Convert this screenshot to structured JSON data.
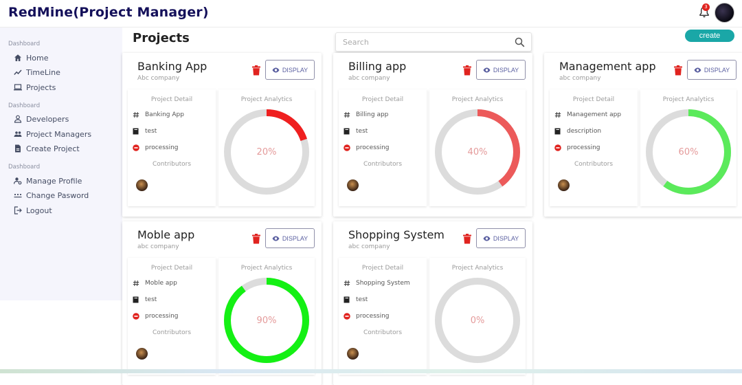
{
  "app": {
    "title": "RedMine(Project Manager)",
    "notification_count": "3"
  },
  "sidebar": {
    "sections": [
      {
        "title": "Dashboard",
        "items": [
          {
            "label": "Home",
            "icon": "home-icon"
          },
          {
            "label": "TimeLine",
            "icon": "timeline-icon"
          },
          {
            "label": "Projects",
            "icon": "laptop-icon"
          }
        ]
      },
      {
        "title": "Dashboard",
        "items": [
          {
            "label": "Developers",
            "icon": "person-icon"
          },
          {
            "label": "Project Managers",
            "icon": "group-icon"
          },
          {
            "label": "Create Project",
            "icon": "document-icon"
          }
        ]
      },
      {
        "title": "Dashboard",
        "items": [
          {
            "label": "Manage Profile",
            "icon": "manage-profile-icon"
          },
          {
            "label": "Change Pasword",
            "icon": "password-icon"
          },
          {
            "label": "Logout",
            "icon": "logout-icon"
          }
        ]
      }
    ]
  },
  "main": {
    "title": "Projects",
    "search_placeholder": "Search",
    "create_label": "create",
    "display_label": "DISPLAY",
    "detail_header": "Project Detail",
    "analytics_header": "Project Analytics",
    "contributors_label": "Contributors",
    "colors": {
      "progress_low": "#ef1f1f",
      "progress_mid": "#ec5a5a",
      "progress_high": "#5bea5b",
      "progress_full": "#14f014",
      "track": "#dcdcdc",
      "status_red": "#e0231f",
      "create_bg": "#1aa7a7"
    },
    "projects": [
      {
        "name": "Banking App",
        "company": "Abc company",
        "detail_name": "Banking App",
        "description": "test",
        "status": "processing",
        "progress": 20,
        "progress_label": "20%"
      },
      {
        "name": "Billing app",
        "company": "abc company",
        "detail_name": "Billing app",
        "description": "test",
        "status": "processing",
        "progress": 40,
        "progress_label": "40%"
      },
      {
        "name": "Management app",
        "company": "abc company",
        "detail_name": "Management app",
        "description": "description",
        "status": "processing",
        "progress": 60,
        "progress_label": "60%"
      },
      {
        "name": "Moble app",
        "company": "abc company",
        "detail_name": "Moble app",
        "description": "test",
        "status": "processing",
        "progress": 90,
        "progress_label": "90%"
      },
      {
        "name": "Shopping System",
        "company": "abc company",
        "detail_name": "Shopping System",
        "description": "test",
        "status": "processing",
        "progress": 0,
        "progress_label": "0%"
      }
    ]
  }
}
